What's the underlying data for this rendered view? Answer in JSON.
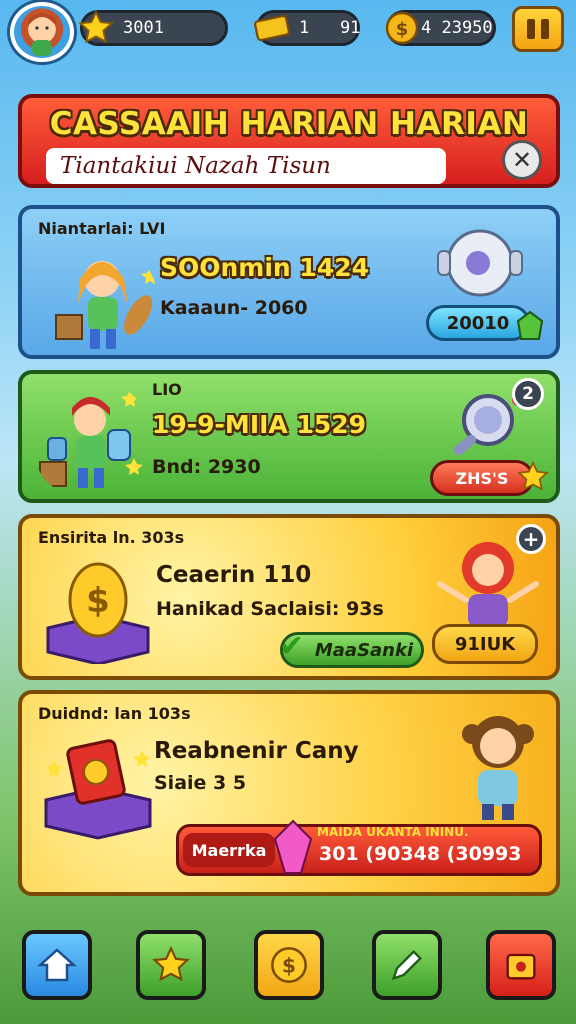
{
  "hud": {
    "stars": "3001",
    "tickets": "1   91",
    "coins": "4 23950",
    "pause_icon": "pause-icon",
    "avatar_icon": "player-avatar"
  },
  "banner": {
    "title": "CASSAAIH HARIAN HARIAN",
    "subtitle": "Tiantakiui Nazah Tisun",
    "close_icon": "close-icon"
  },
  "cards": [
    {
      "header": "Niantarlai: LVI",
      "title": "SOOnmin 1424",
      "detail": "Kaaaun- 2060",
      "reward": "20010",
      "reward_item_icon": "robot-head-icon"
    },
    {
      "header": "LIO",
      "title": "19-9-MIIA 1529",
      "detail": "Bnd: 2930",
      "reward": "ZHS'S",
      "badge": "2",
      "reward_item_icon": "magnifier-icon"
    },
    {
      "header": "Ensirita ln. 303s",
      "title": "Ceaerin 110",
      "detail": "Hanikad Saclaisi: 93s",
      "action": "MaaSanki",
      "reward": "91IUK",
      "badge": "+",
      "reward_item_icon": "gold-coin-icon"
    },
    {
      "header": "Duidnd: lan 103s",
      "title": "Reabnenir Cany",
      "detail": "Siaie 3 5",
      "action": "Maerrka",
      "reward_title": "MAIDA UKANTA ININU.",
      "reward": "301 (90348 (30993",
      "reward_item_icon": "red-gift-icon"
    }
  ],
  "nav": [
    {
      "icon": "home-icon"
    },
    {
      "icon": "star-icon"
    },
    {
      "icon": "coin-icon"
    },
    {
      "icon": "pencil-icon"
    },
    {
      "icon": "shop-icon"
    }
  ],
  "colors": {
    "banner": "#d61f1f",
    "card_blue": "#5aa8e8",
    "card_green": "#4cb338",
    "card_yellow": "#ffce3a",
    "text_outline": "#4a2a0a"
  }
}
